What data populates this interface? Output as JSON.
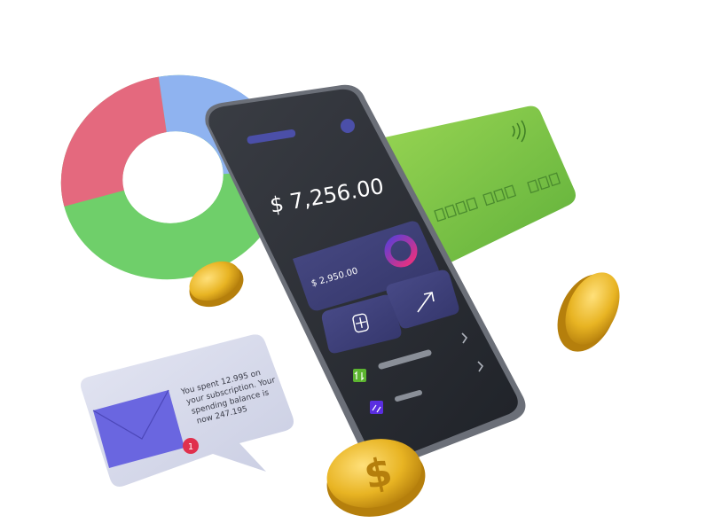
{
  "phone": {
    "balance": "$ 7,256.00",
    "card_amount": "$ 2,950.00",
    "add_icon": "plus-square-icon",
    "send_icon": "arrow-up-right-icon",
    "list_icons": [
      "transfer-icon",
      "exchange-icon"
    ]
  },
  "notification": {
    "lines": [
      "You spent 12.995 on",
      "your subscription. Your",
      "spending balance is",
      "now 247.195"
    ],
    "badge_count": "1",
    "icon": "envelope-icon"
  },
  "colors": {
    "phone_body": "#2b2e35",
    "card_green": "#7cc242",
    "donut_red": "#e4697e",
    "donut_blue": "#8fb3f0",
    "donut_green": "#6fcf6a",
    "coin_gold": "#e8b423",
    "accent_purple": "#5b55c9",
    "badge_red": "#e0304d"
  }
}
